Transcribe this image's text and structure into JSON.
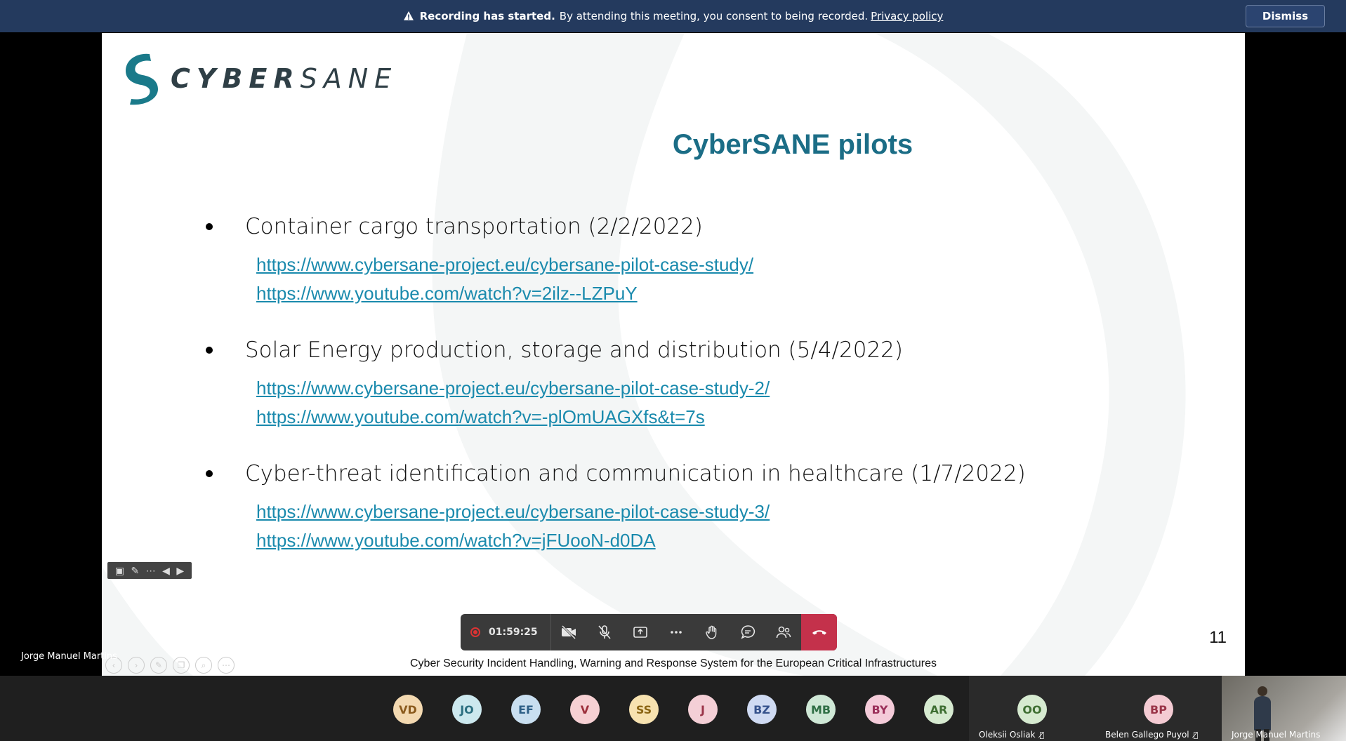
{
  "banner": {
    "bold": "Recording has started.",
    "message": "By attending this meeting, you consent to being recorded.",
    "link": "Privacy policy",
    "dismiss": "Dismiss"
  },
  "slide": {
    "logo_prefix": "CYBER",
    "logo_suffix": "SANE",
    "title": "CyberSANE pilots",
    "bullets": [
      {
        "text": "Container cargo transportation (2/2/2022)",
        "links": [
          "https://www.cybersane-project.eu/cybersane-pilot-case-study/",
          "https://www.youtube.com/watch?v=2ilz--LZPuY"
        ]
      },
      {
        "text": "Solar Energy production, storage and distribution (5/4/2022)",
        "links": [
          "https://www.cybersane-project.eu/cybersane-pilot-case-study-2/",
          "https://www.youtube.com/watch?v=-plOmUAGXfs&t=7s"
        ]
      },
      {
        "text": "Cyber-threat identification and communication in healthcare (1/7/2022)",
        "links": [
          "https://www.cybersane-project.eu/cybersane-pilot-case-study-3/",
          "https://www.youtube.com/watch?v=jFUooN-d0DA"
        ]
      }
    ],
    "footer": "Cyber Security Incident Handling, Warning and Response System for the European Critical Infrastructures",
    "page_number": "11"
  },
  "presenter_label": "Jorge Manuel Martins",
  "controls": {
    "timer": "01:59:25"
  },
  "participants": [
    {
      "initials": "VD",
      "bg": "#f3d9b1",
      "fg": "#8a5a1c"
    },
    {
      "initials": "JO",
      "bg": "#cce8ee",
      "fg": "#2b6f80"
    },
    {
      "initials": "EF",
      "bg": "#c9dff0",
      "fg": "#2d5f86"
    },
    {
      "initials": "V",
      "bg": "#f6d0d3",
      "fg": "#9c2f3b"
    },
    {
      "initials": "SS",
      "bg": "#f7e2b0",
      "fg": "#8a6412"
    },
    {
      "initials": "J",
      "bg": "#f4cfd6",
      "fg": "#9a3448"
    },
    {
      "initials": "BZ",
      "bg": "#cfdaf2",
      "fg": "#36528c"
    },
    {
      "initials": "MB",
      "bg": "#cfe8d6",
      "fg": "#2f6f45"
    },
    {
      "initials": "BY",
      "bg": "#f4cbd9",
      "fg": "#9b2f5a"
    },
    {
      "initials": "AR",
      "bg": "#d6ead0",
      "fg": "#3e6e32"
    }
  ],
  "named_tiles": [
    {
      "initials": "OO",
      "name": "Oleksii Osliak",
      "bg": "#d6ead0",
      "fg": "#3e6e32"
    },
    {
      "initials": "BP",
      "name": "Belen Gallego Puyol",
      "bg": "#f4cbd3",
      "fg": "#9a3448"
    }
  ],
  "video_tile": {
    "name": "Jorge Manuel Martins"
  }
}
